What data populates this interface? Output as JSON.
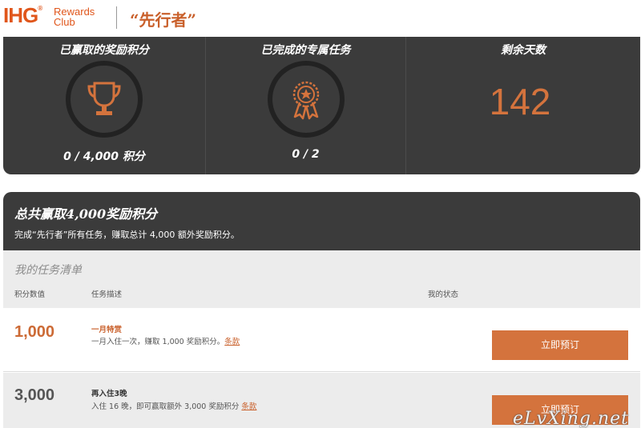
{
  "header": {
    "logo_ihg": "IHG",
    "logo_reg": "®",
    "logo_rewards_line1": "Rewards",
    "logo_rewards_line2": "Club",
    "promo_title": "“先行者”"
  },
  "stats": [
    {
      "title": "已赢取的奖励积分",
      "value": "0 / 4,000 积分",
      "icon": "trophy-icon"
    },
    {
      "title": "已完成的专属任务",
      "value": "0 / 2",
      "icon": "award-ribbon-icon"
    },
    {
      "title": "剩余天数",
      "value": "142"
    }
  ],
  "bonus": {
    "title": "总共赢取4,000奖励积分",
    "subtitle": "完成“先行者”所有任务，赚取总计 4,000 额外奖励积分。"
  },
  "tasks": {
    "title": "我的任务清单",
    "columns": {
      "points": "积分数值",
      "description": "任务描述",
      "status": "我的状态"
    },
    "rows": [
      {
        "points": "1,000",
        "name": "一月特赏",
        "desc": "一月入住一次，赚取 1,000 奖励积分。",
        "link": "条款",
        "button": "立即预订"
      },
      {
        "points": "3,000",
        "name": "再入住3晚",
        "desc": "入住 16 晚，即可赢取额外 3,000 奖励积分",
        "link": "条款",
        "button": "立即预订"
      }
    ]
  },
  "watermark": "eLvXing.net",
  "colors": {
    "accent": "#d4733d",
    "panel": "#3b3b3b",
    "brand": "#e0561b"
  }
}
